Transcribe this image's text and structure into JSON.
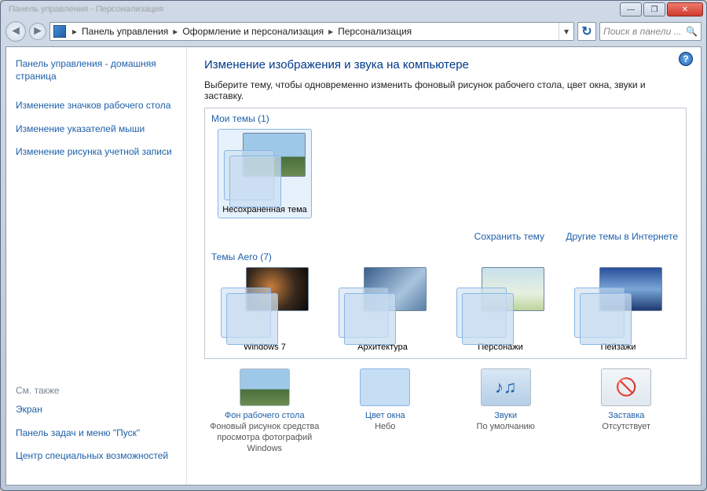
{
  "window": {
    "title": "Панель управления - Персонализация"
  },
  "winbtns": {
    "min": "—",
    "max": "❐",
    "close": "✕"
  },
  "nav": {
    "crumbs": [
      "Панель управления",
      "Оформление и персонализация",
      "Персонализация"
    ],
    "search_placeholder": "Поиск в панели ..."
  },
  "sidebar": {
    "home": "Панель управления - домашняя страница",
    "links": [
      "Изменение значков рабочего стола",
      "Изменение указателей мыши",
      "Изменение рисунка учетной записи"
    ],
    "see_also_hdr": "См. также",
    "see_also": [
      "Экран",
      "Панель задач и меню \"Пуск\"",
      "Центр специальных возможностей"
    ]
  },
  "main": {
    "heading": "Изменение изображения и звука на компьютере",
    "desc": "Выберите тему, чтобы одновременно изменить фоновый рисунок рабочего стола, цвет окна, звуки и заставку.",
    "my_themes_hdr": "Мои темы (1)",
    "my_theme_label": "Несохраненная тема",
    "save_theme": "Сохранить тему",
    "more_online": "Другие темы в Интернете",
    "aero_hdr": "Темы Aero (7)",
    "aero": [
      "Windows 7",
      "Архитектура",
      "Персонажи",
      "Пейзажи"
    ]
  },
  "bottom": {
    "bg": {
      "label": "Фон рабочего стола",
      "value": "Фоновый рисунок средства просмотра фотографий Windows"
    },
    "color": {
      "label": "Цвет окна",
      "value": "Небо"
    },
    "sound": {
      "label": "Звуки",
      "value": "По умолчанию"
    },
    "saver": {
      "label": "Заставка",
      "value": "Отсутствует"
    }
  }
}
